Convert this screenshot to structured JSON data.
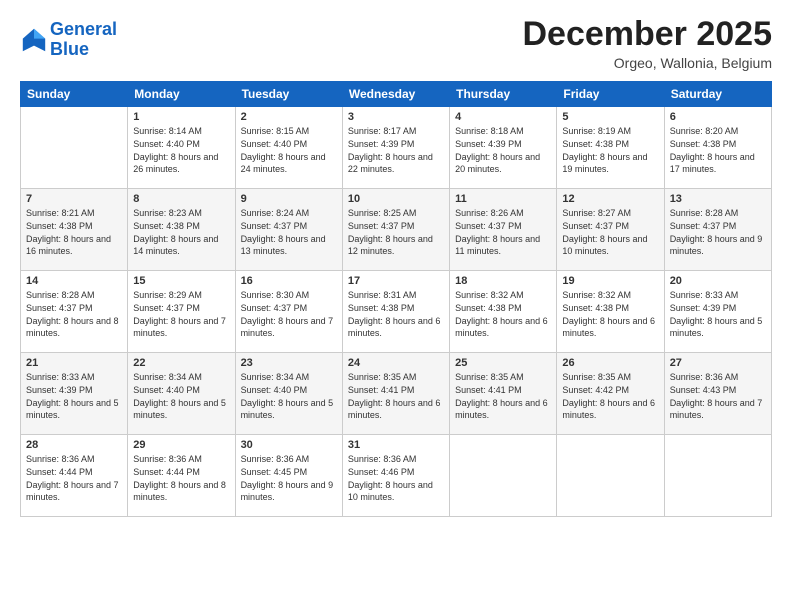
{
  "logo": {
    "line1": "General",
    "line2": "Blue"
  },
  "header": {
    "month": "December 2025",
    "location": "Orgeo, Wallonia, Belgium"
  },
  "weekdays": [
    "Sunday",
    "Monday",
    "Tuesday",
    "Wednesday",
    "Thursday",
    "Friday",
    "Saturday"
  ],
  "weeks": [
    [
      {
        "day": "",
        "sunrise": "",
        "sunset": "",
        "daylight": ""
      },
      {
        "day": "1",
        "sunrise": "Sunrise: 8:14 AM",
        "sunset": "Sunset: 4:40 PM",
        "daylight": "Daylight: 8 hours and 26 minutes."
      },
      {
        "day": "2",
        "sunrise": "Sunrise: 8:15 AM",
        "sunset": "Sunset: 4:40 PM",
        "daylight": "Daylight: 8 hours and 24 minutes."
      },
      {
        "day": "3",
        "sunrise": "Sunrise: 8:17 AM",
        "sunset": "Sunset: 4:39 PM",
        "daylight": "Daylight: 8 hours and 22 minutes."
      },
      {
        "day": "4",
        "sunrise": "Sunrise: 8:18 AM",
        "sunset": "Sunset: 4:39 PM",
        "daylight": "Daylight: 8 hours and 20 minutes."
      },
      {
        "day": "5",
        "sunrise": "Sunrise: 8:19 AM",
        "sunset": "Sunset: 4:38 PM",
        "daylight": "Daylight: 8 hours and 19 minutes."
      },
      {
        "day": "6",
        "sunrise": "Sunrise: 8:20 AM",
        "sunset": "Sunset: 4:38 PM",
        "daylight": "Daylight: 8 hours and 17 minutes."
      }
    ],
    [
      {
        "day": "7",
        "sunrise": "Sunrise: 8:21 AM",
        "sunset": "Sunset: 4:38 PM",
        "daylight": "Daylight: 8 hours and 16 minutes."
      },
      {
        "day": "8",
        "sunrise": "Sunrise: 8:23 AM",
        "sunset": "Sunset: 4:38 PM",
        "daylight": "Daylight: 8 hours and 14 minutes."
      },
      {
        "day": "9",
        "sunrise": "Sunrise: 8:24 AM",
        "sunset": "Sunset: 4:37 PM",
        "daylight": "Daylight: 8 hours and 13 minutes."
      },
      {
        "day": "10",
        "sunrise": "Sunrise: 8:25 AM",
        "sunset": "Sunset: 4:37 PM",
        "daylight": "Daylight: 8 hours and 12 minutes."
      },
      {
        "day": "11",
        "sunrise": "Sunrise: 8:26 AM",
        "sunset": "Sunset: 4:37 PM",
        "daylight": "Daylight: 8 hours and 11 minutes."
      },
      {
        "day": "12",
        "sunrise": "Sunrise: 8:27 AM",
        "sunset": "Sunset: 4:37 PM",
        "daylight": "Daylight: 8 hours and 10 minutes."
      },
      {
        "day": "13",
        "sunrise": "Sunrise: 8:28 AM",
        "sunset": "Sunset: 4:37 PM",
        "daylight": "Daylight: 8 hours and 9 minutes."
      }
    ],
    [
      {
        "day": "14",
        "sunrise": "Sunrise: 8:28 AM",
        "sunset": "Sunset: 4:37 PM",
        "daylight": "Daylight: 8 hours and 8 minutes."
      },
      {
        "day": "15",
        "sunrise": "Sunrise: 8:29 AM",
        "sunset": "Sunset: 4:37 PM",
        "daylight": "Daylight: 8 hours and 7 minutes."
      },
      {
        "day": "16",
        "sunrise": "Sunrise: 8:30 AM",
        "sunset": "Sunset: 4:37 PM",
        "daylight": "Daylight: 8 hours and 7 minutes."
      },
      {
        "day": "17",
        "sunrise": "Sunrise: 8:31 AM",
        "sunset": "Sunset: 4:38 PM",
        "daylight": "Daylight: 8 hours and 6 minutes."
      },
      {
        "day": "18",
        "sunrise": "Sunrise: 8:32 AM",
        "sunset": "Sunset: 4:38 PM",
        "daylight": "Daylight: 8 hours and 6 minutes."
      },
      {
        "day": "19",
        "sunrise": "Sunrise: 8:32 AM",
        "sunset": "Sunset: 4:38 PM",
        "daylight": "Daylight: 8 hours and 6 minutes."
      },
      {
        "day": "20",
        "sunrise": "Sunrise: 8:33 AM",
        "sunset": "Sunset: 4:39 PM",
        "daylight": "Daylight: 8 hours and 5 minutes."
      }
    ],
    [
      {
        "day": "21",
        "sunrise": "Sunrise: 8:33 AM",
        "sunset": "Sunset: 4:39 PM",
        "daylight": "Daylight: 8 hours and 5 minutes."
      },
      {
        "day": "22",
        "sunrise": "Sunrise: 8:34 AM",
        "sunset": "Sunset: 4:40 PM",
        "daylight": "Daylight: 8 hours and 5 minutes."
      },
      {
        "day": "23",
        "sunrise": "Sunrise: 8:34 AM",
        "sunset": "Sunset: 4:40 PM",
        "daylight": "Daylight: 8 hours and 5 minutes."
      },
      {
        "day": "24",
        "sunrise": "Sunrise: 8:35 AM",
        "sunset": "Sunset: 4:41 PM",
        "daylight": "Daylight: 8 hours and 6 minutes."
      },
      {
        "day": "25",
        "sunrise": "Sunrise: 8:35 AM",
        "sunset": "Sunset: 4:41 PM",
        "daylight": "Daylight: 8 hours and 6 minutes."
      },
      {
        "day": "26",
        "sunrise": "Sunrise: 8:35 AM",
        "sunset": "Sunset: 4:42 PM",
        "daylight": "Daylight: 8 hours and 6 minutes."
      },
      {
        "day": "27",
        "sunrise": "Sunrise: 8:36 AM",
        "sunset": "Sunset: 4:43 PM",
        "daylight": "Daylight: 8 hours and 7 minutes."
      }
    ],
    [
      {
        "day": "28",
        "sunrise": "Sunrise: 8:36 AM",
        "sunset": "Sunset: 4:44 PM",
        "daylight": "Daylight: 8 hours and 7 minutes."
      },
      {
        "day": "29",
        "sunrise": "Sunrise: 8:36 AM",
        "sunset": "Sunset: 4:44 PM",
        "daylight": "Daylight: 8 hours and 8 minutes."
      },
      {
        "day": "30",
        "sunrise": "Sunrise: 8:36 AM",
        "sunset": "Sunset: 4:45 PM",
        "daylight": "Daylight: 8 hours and 9 minutes."
      },
      {
        "day": "31",
        "sunrise": "Sunrise: 8:36 AM",
        "sunset": "Sunset: 4:46 PM",
        "daylight": "Daylight: 8 hours and 10 minutes."
      },
      {
        "day": "",
        "sunrise": "",
        "sunset": "",
        "daylight": ""
      },
      {
        "day": "",
        "sunrise": "",
        "sunset": "",
        "daylight": ""
      },
      {
        "day": "",
        "sunrise": "",
        "sunset": "",
        "daylight": ""
      }
    ]
  ]
}
